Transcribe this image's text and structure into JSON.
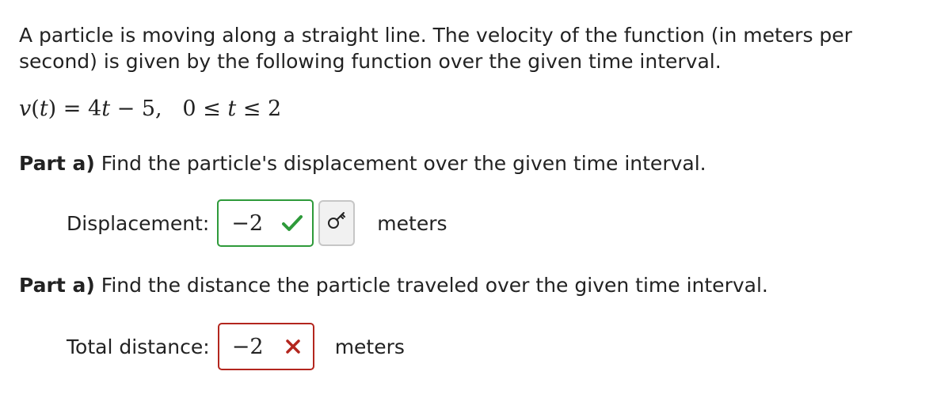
{
  "question": {
    "intro_line1": "A particle is moving along a straight line. The velocity of the function (in meters per",
    "intro_line2": "second) is given by the following function over the given time interval.",
    "formula": {
      "lhs_var": "v",
      "lhs_open": "(",
      "lhs_arg": "t",
      "lhs_close": ")",
      "eq": " = ",
      "coef": "4",
      "var": "t",
      "rest": " − 5,   0 ≤ ",
      "var2": "t",
      "end": " ≤ 2"
    }
  },
  "part_displacement": {
    "heading_bold": "Part a)",
    "heading_text": " Find the particle's displacement over the given time interval.",
    "label": "Displacement:",
    "value": "−2",
    "status": "correct",
    "status_icon": "checkmark-icon",
    "key_icon": "key-icon",
    "units": "meters"
  },
  "part_distance": {
    "heading_bold": "Part a)",
    "heading_text": " Find the distance the particle traveled over the given time interval.",
    "label": "Total distance:",
    "value": "−2",
    "status": "incorrect",
    "status_icon": "cross-icon",
    "units": "meters"
  },
  "colors": {
    "correct": "#2e9a3a",
    "incorrect": "#b3261e"
  }
}
